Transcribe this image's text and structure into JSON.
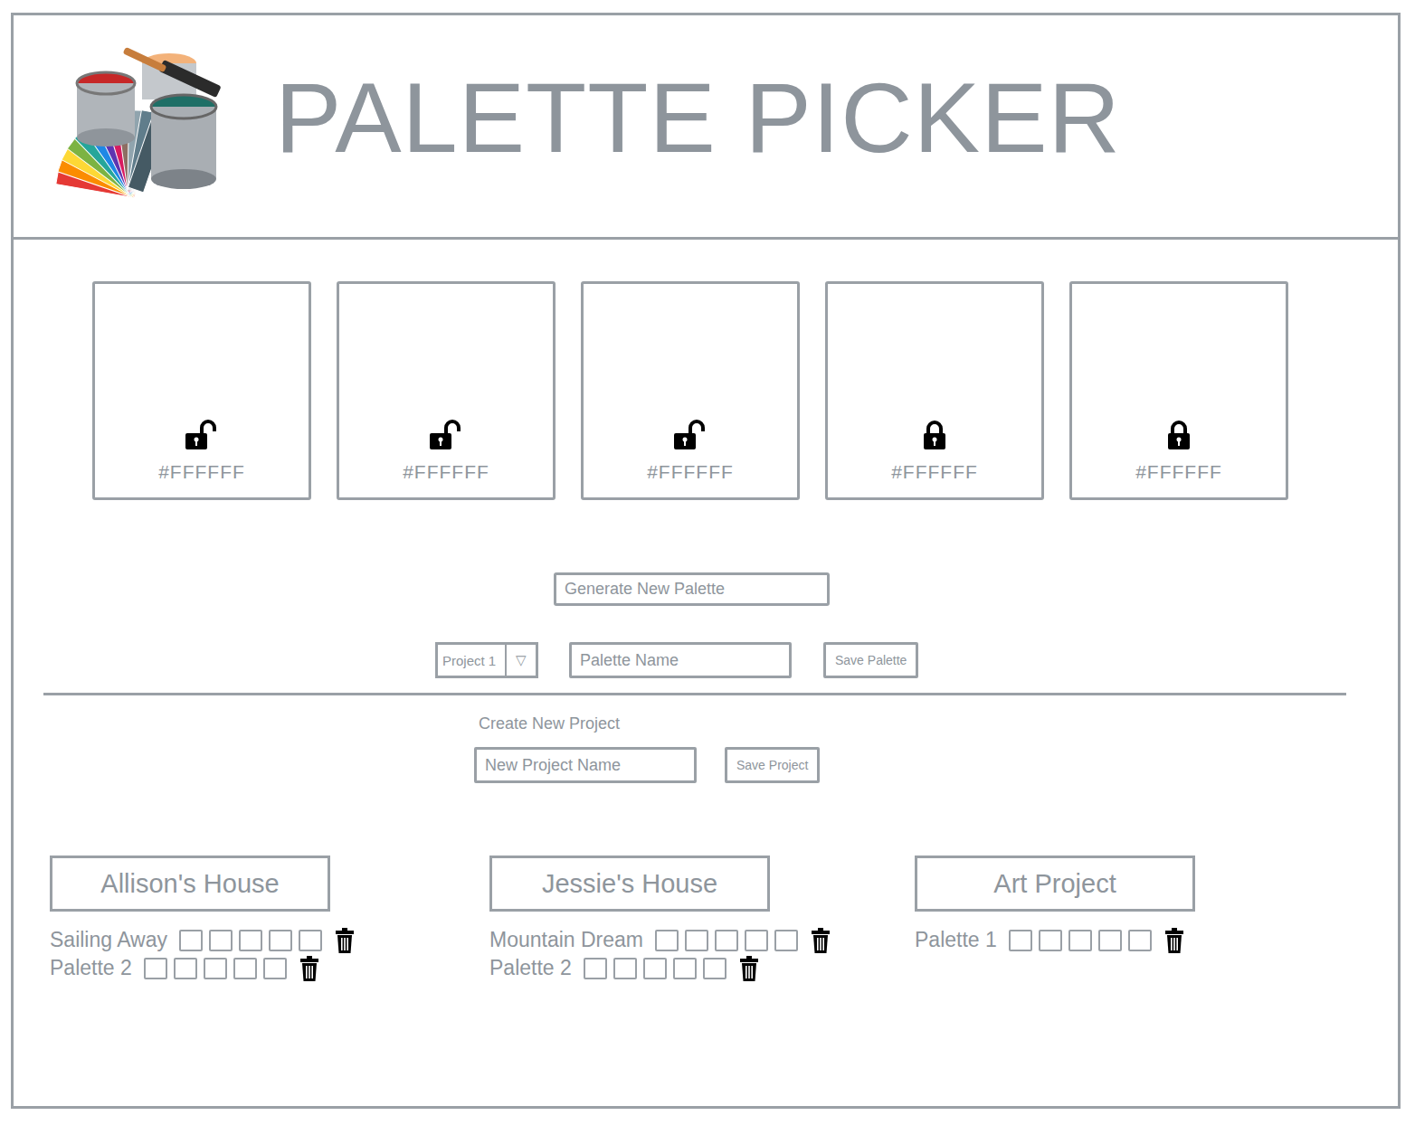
{
  "app": {
    "title": "PALETTE PICKER"
  },
  "swatches": [
    {
      "hex": "#FFFFFF",
      "locked": false
    },
    {
      "hex": "#FFFFFF",
      "locked": false
    },
    {
      "hex": "#FFFFFF",
      "locked": false
    },
    {
      "hex": "#FFFFFF",
      "locked": true
    },
    {
      "hex": "#FFFFFF",
      "locked": true
    }
  ],
  "generate_button": "Generate New Palette",
  "save_palette": {
    "project_select": {
      "value": "Project 1",
      "arrow": "▽"
    },
    "name_placeholder": "Palette Name",
    "button": "Save Palette"
  },
  "create_project": {
    "heading": "Create New Project",
    "name_placeholder": "New Project Name",
    "button": "Save Project"
  },
  "projects": [
    {
      "name": "Allison's House",
      "palettes": [
        {
          "name": "Sailing Away",
          "colors": [
            "#FFFFFF",
            "#FFFFFF",
            "#FFFFFF",
            "#FFFFFF",
            "#FFFFFF"
          ]
        },
        {
          "name": "Palette 2",
          "colors": [
            "#FFFFFF",
            "#FFFFFF",
            "#FFFFFF",
            "#FFFFFF",
            "#FFFFFF"
          ]
        }
      ]
    },
    {
      "name": "Jessie's House",
      "palettes": [
        {
          "name": "Mountain Dream",
          "colors": [
            "#FFFFFF",
            "#FFFFFF",
            "#FFFFFF",
            "#FFFFFF",
            "#FFFFFF"
          ]
        },
        {
          "name": "Palette 2",
          "colors": [
            "#FFFFFF",
            "#FFFFFF",
            "#FFFFFF",
            "#FFFFFF",
            "#FFFFFF"
          ]
        }
      ]
    },
    {
      "name": "Art Project",
      "palettes": [
        {
          "name": "Palette 1",
          "colors": [
            "#FFFFFF",
            "#FFFFFF",
            "#FFFFFF",
            "#FFFFFF",
            "#FFFFFF"
          ]
        }
      ]
    }
  ]
}
